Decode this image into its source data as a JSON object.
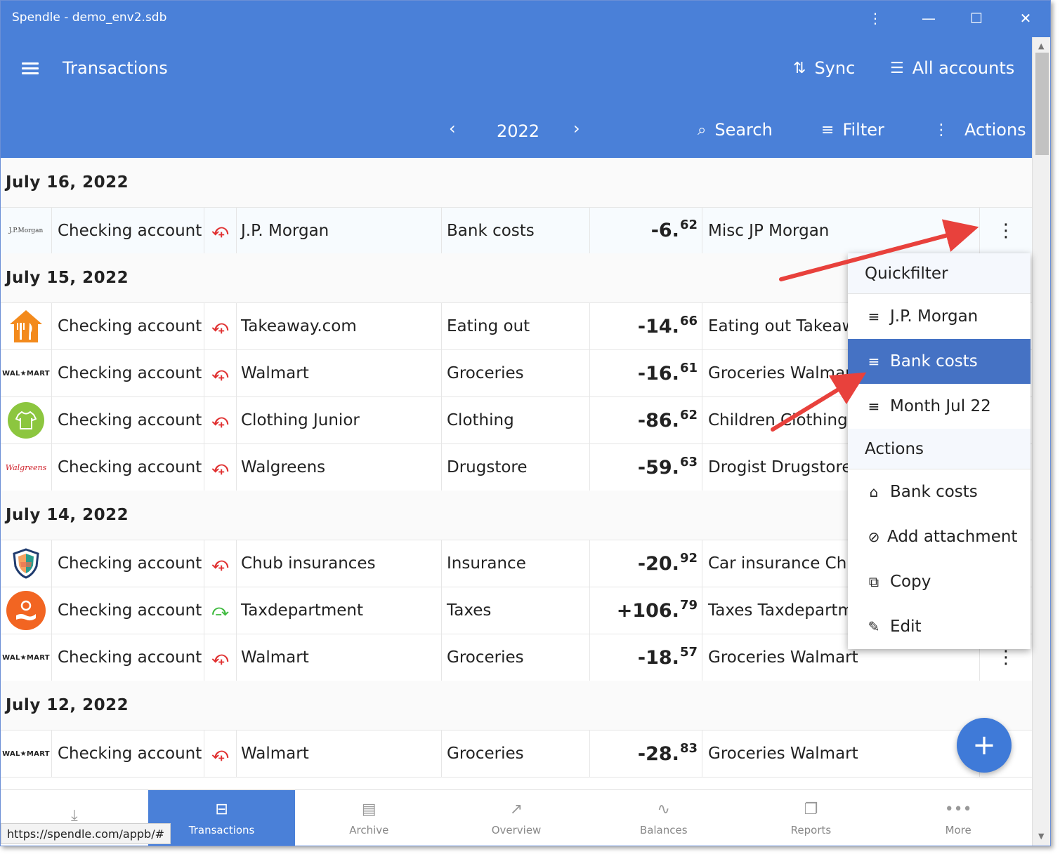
{
  "window": {
    "title": "Spendle - demo_env2.sdb"
  },
  "appbar": {
    "title": "Transactions",
    "sync_label": "Sync",
    "accounts_label": "All accounts",
    "year": "2022",
    "search_label": "Search",
    "filter_label": "Filter",
    "actions_label": "Actions"
  },
  "groups": [
    {
      "date": "July 16, 2022",
      "rows": [
        {
          "logo": "J.P.Morgan",
          "account": "Checking account",
          "dir": "out",
          "payee": "J.P. Morgan",
          "category": "Bank costs",
          "amount_main": "-6.",
          "amount_cents": "62",
          "desc": "Misc JP Morgan"
        }
      ]
    },
    {
      "date": "July 15, 2022",
      "rows": [
        {
          "logo": "takeaway",
          "account": "Checking account",
          "dir": "out",
          "payee": "Takeaway.com",
          "category": "Eating out",
          "amount_main": "-14.",
          "amount_cents": "66",
          "desc": "Eating out Takeaw"
        },
        {
          "logo": "WAL★MART",
          "account": "Checking account",
          "dir": "out",
          "payee": "Walmart",
          "category": "Groceries",
          "amount_main": "-16.",
          "amount_cents": "61",
          "desc": "Groceries Walmar"
        },
        {
          "logo": "clothing",
          "account": "Checking account",
          "dir": "out",
          "payee": "Clothing Junior",
          "category": "Clothing",
          "amount_main": "-86.",
          "amount_cents": "62",
          "desc": "Children Clothing"
        },
        {
          "logo": "Walgreens",
          "account": "Checking account",
          "dir": "out",
          "payee": "Walgreens",
          "category": "Drugstore",
          "amount_main": "-59.",
          "amount_cents": "63",
          "desc": "Drogist Drugstore"
        }
      ]
    },
    {
      "date": "July 14, 2022",
      "rows": [
        {
          "logo": "shield",
          "account": "Checking account",
          "dir": "out",
          "payee": "Chub insurances",
          "category": "Insurance",
          "amount_main": "-20.",
          "amount_cents": "92",
          "desc": "Car insurance Chu"
        },
        {
          "logo": "tax",
          "account": "Checking account",
          "dir": "in",
          "payee": "Taxdepartment",
          "category": "Taxes",
          "amount_main": "+106.",
          "amount_cents": "79",
          "desc": "Taxes Taxdepartm"
        },
        {
          "logo": "WAL★MART",
          "account": "Checking account",
          "dir": "out",
          "payee": "Walmart",
          "category": "Groceries",
          "amount_main": "-18.",
          "amount_cents": "57",
          "desc": "Groceries Walmart"
        }
      ]
    },
    {
      "date": "July 12, 2022",
      "rows": [
        {
          "logo": "WAL★MART",
          "account": "Checking account",
          "dir": "out",
          "payee": "Walmart",
          "category": "Groceries",
          "amount_main": "-28.",
          "amount_cents": "83",
          "desc": "Groceries Walmart"
        }
      ]
    }
  ],
  "context_menu": {
    "quickfilter_header": "Quickfilter",
    "quickfilter_items": [
      "J.P. Morgan",
      "Bank costs",
      "Month Jul 22"
    ],
    "actions_header": "Actions",
    "action_items": [
      "Bank costs",
      "Add attachment",
      "Copy",
      "Edit"
    ]
  },
  "bottom_nav": [
    "Transactions",
    "Archive",
    "Overview",
    "Balances",
    "Reports",
    "More"
  ],
  "status_url": "https://spendle.com/appb/#",
  "colors": {
    "primary": "#4a80d8",
    "menu_active": "#4572c4",
    "expense_icon": "#e03030",
    "income_icon": "#3fba3f"
  }
}
